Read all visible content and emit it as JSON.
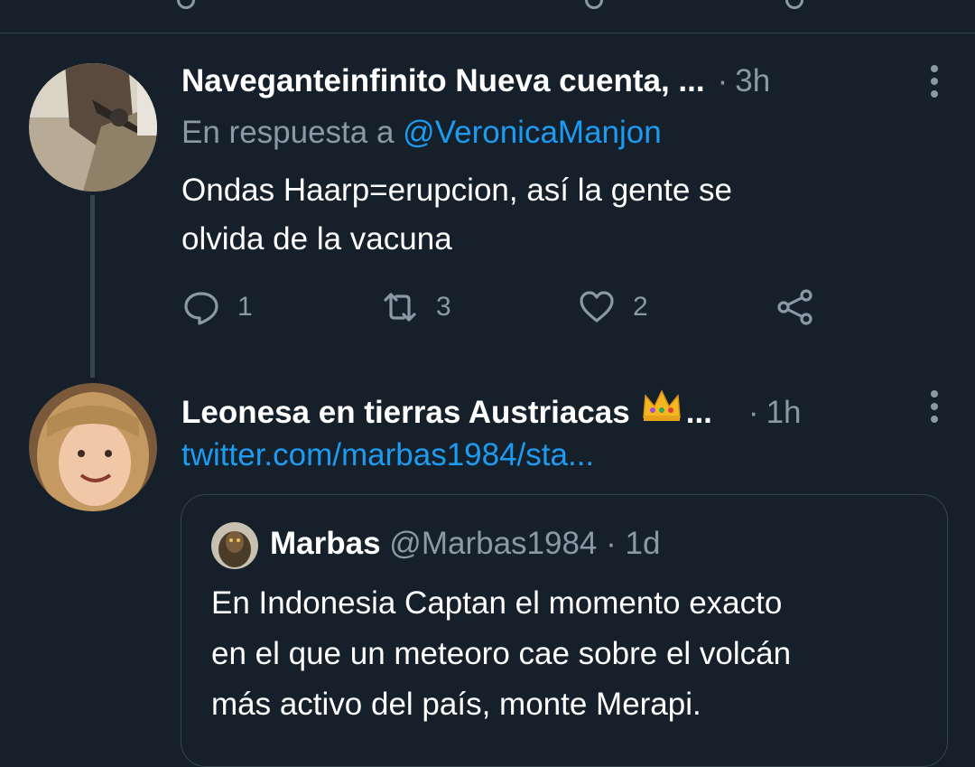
{
  "tweets": [
    {
      "display_name": "Naveganteinfinito Nueva cuenta, ...",
      "separator": "·",
      "time": "3h",
      "reply_prefix": "En respuesta a",
      "reply_handle": "@VeronicaManjon",
      "text_line1": "Ondas Haarp=erupcion, así la gente se",
      "text_line2": "olvida de la vacuna",
      "reply_count": "1",
      "retweet_count": "3",
      "like_count": "2"
    },
    {
      "display_name": "Leonesa en tierras Austriacas",
      "name_suffix": "...",
      "separator": "·",
      "time": "1h",
      "link": "twitter.com/marbas1984/sta..."
    }
  ],
  "quote": {
    "name": "Marbas",
    "handle": "@Marbas1984",
    "separator": "·",
    "time": "1d",
    "line1": "En Indonesia Captan el momento exacto",
    "line2": "en el que un meteoro cae sobre el volcán",
    "line3": "más activo del país, monte Merapi."
  },
  "colors": {
    "background": "#15202b",
    "accent": "#1d9bf0",
    "muted": "#8b98a5",
    "border": "#38444d"
  },
  "icons": [
    "reply-icon",
    "retweet-icon",
    "like-icon",
    "share-icon",
    "more-icon",
    "crown-emoji"
  ]
}
